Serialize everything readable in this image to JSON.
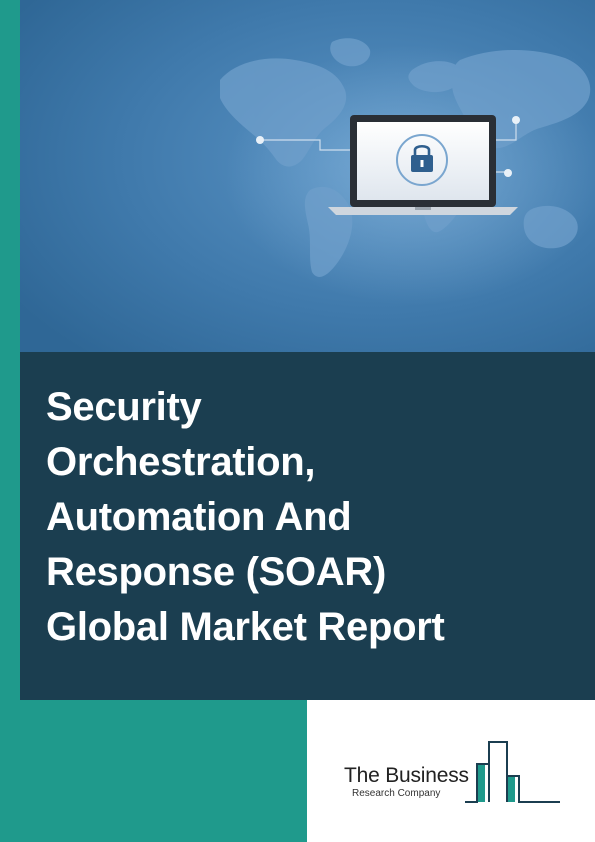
{
  "cover": {
    "title_lines": [
      "Security",
      "Orchestration,",
      "Automation And",
      "Response (SOAR)",
      "Global Market Report"
    ],
    "colors": {
      "accent_teal": "#1f9a8c",
      "title_panel": "#1b3e50",
      "hero_blue": "#3f79ab"
    },
    "hero_icons": [
      "world-map-icon",
      "laptop-icon",
      "padlock-icon"
    ]
  },
  "logo": {
    "name": "The Business",
    "subname": "Research Company"
  }
}
